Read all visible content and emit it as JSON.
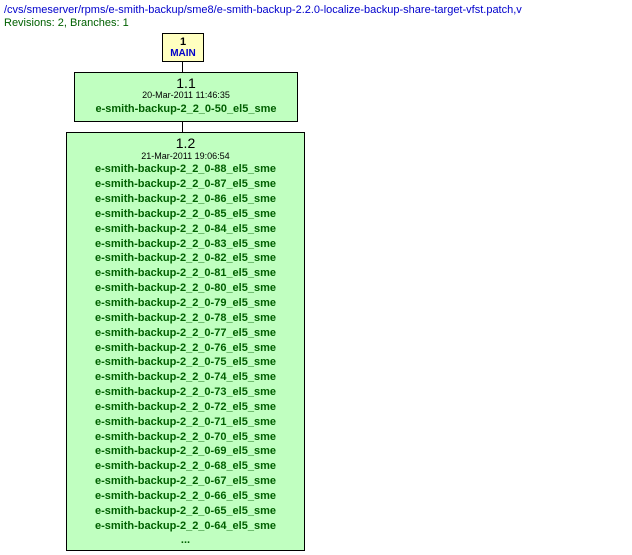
{
  "header": {
    "path": "/cvs/smeserver/rpms/e-smith-backup/sme8/e-smith-backup-2.2.0-localize-backup-share-target-vfst.patch,v",
    "subtitle": "Revisions: 2, Branches: 1"
  },
  "root": {
    "number": "1",
    "label": "MAIN"
  },
  "rev1": {
    "number": "1.1",
    "date": "20-Mar-2011 11:46:35",
    "tags": [
      "e-smith-backup-2_2_0-50_el5_sme"
    ]
  },
  "rev2": {
    "number": "1.2",
    "date": "21-Mar-2011 19:06:54",
    "tags": [
      "e-smith-backup-2_2_0-88_el5_sme",
      "e-smith-backup-2_2_0-87_el5_sme",
      "e-smith-backup-2_2_0-86_el5_sme",
      "e-smith-backup-2_2_0-85_el5_sme",
      "e-smith-backup-2_2_0-84_el5_sme",
      "e-smith-backup-2_2_0-83_el5_sme",
      "e-smith-backup-2_2_0-82_el5_sme",
      "e-smith-backup-2_2_0-81_el5_sme",
      "e-smith-backup-2_2_0-80_el5_sme",
      "e-smith-backup-2_2_0-79_el5_sme",
      "e-smith-backup-2_2_0-78_el5_sme",
      "e-smith-backup-2_2_0-77_el5_sme",
      "e-smith-backup-2_2_0-76_el5_sme",
      "e-smith-backup-2_2_0-75_el5_sme",
      "e-smith-backup-2_2_0-74_el5_sme",
      "e-smith-backup-2_2_0-73_el5_sme",
      "e-smith-backup-2_2_0-72_el5_sme",
      "e-smith-backup-2_2_0-71_el5_sme",
      "e-smith-backup-2_2_0-70_el5_sme",
      "e-smith-backup-2_2_0-69_el5_sme",
      "e-smith-backup-2_2_0-68_el5_sme",
      "e-smith-backup-2_2_0-67_el5_sme",
      "e-smith-backup-2_2_0-66_el5_sme",
      "e-smith-backup-2_2_0-65_el5_sme",
      "e-smith-backup-2_2_0-64_el5_sme"
    ],
    "ellipsis": "..."
  }
}
